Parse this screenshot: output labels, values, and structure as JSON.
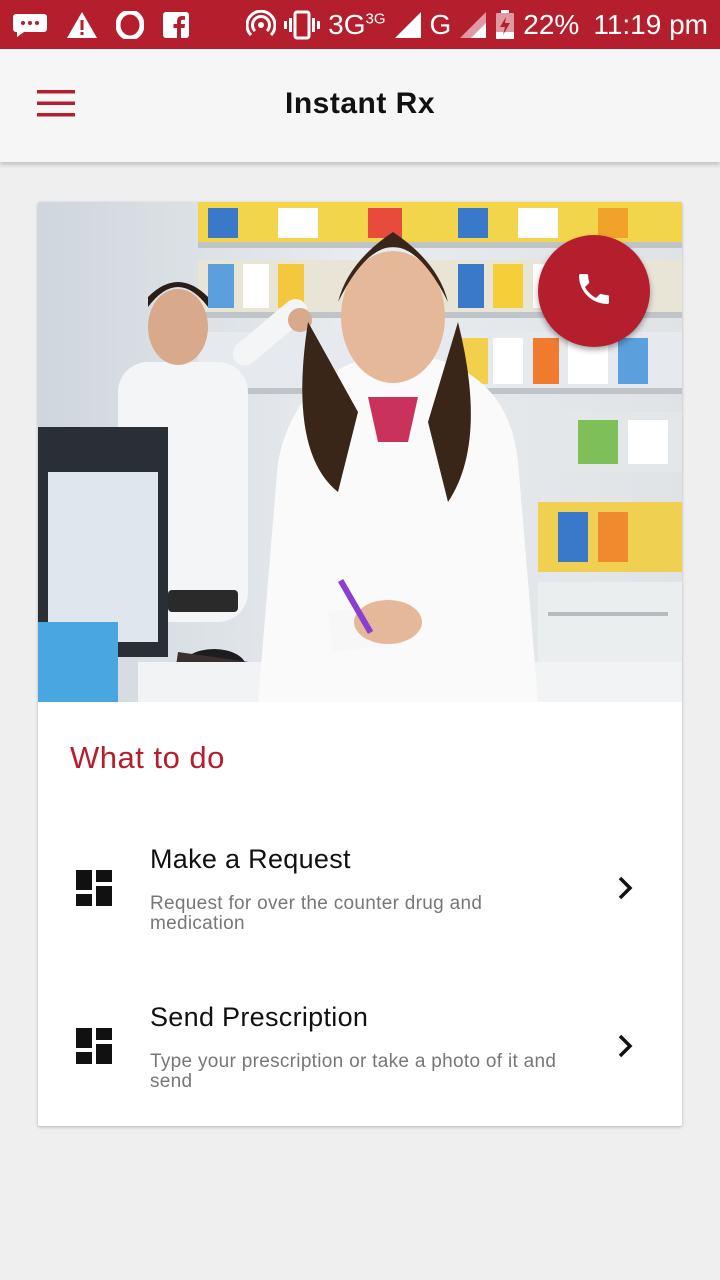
{
  "status_bar": {
    "network_label": "3G",
    "network_sup": "3G",
    "network2_label": "G",
    "battery": "22%",
    "time": "11:19 pm",
    "icons": [
      "messages-icon",
      "warning-icon",
      "opera-icon",
      "facebook-icon",
      "hotspot-icon",
      "vibrate-icon",
      "signal-icon",
      "battery-charging-icon"
    ]
  },
  "app_bar": {
    "title": "Instant Rx",
    "menu_icon": "hamburger-menu-icon"
  },
  "hero": {
    "image": "pharmacists-at-counter-photo",
    "call_icon": "phone-icon"
  },
  "section": {
    "title": "What to do"
  },
  "items": [
    {
      "title": "Make a Request",
      "description": "Request for  over the counter drug and medication",
      "icon": "dashboard-icon"
    },
    {
      "title": "Send Prescription",
      "description": "Type your prescription or take a photo of it and send",
      "icon": "dashboard-icon"
    }
  ],
  "colors": {
    "brand": "#b51f2d",
    "background": "#efefef",
    "card": "#ffffff"
  }
}
